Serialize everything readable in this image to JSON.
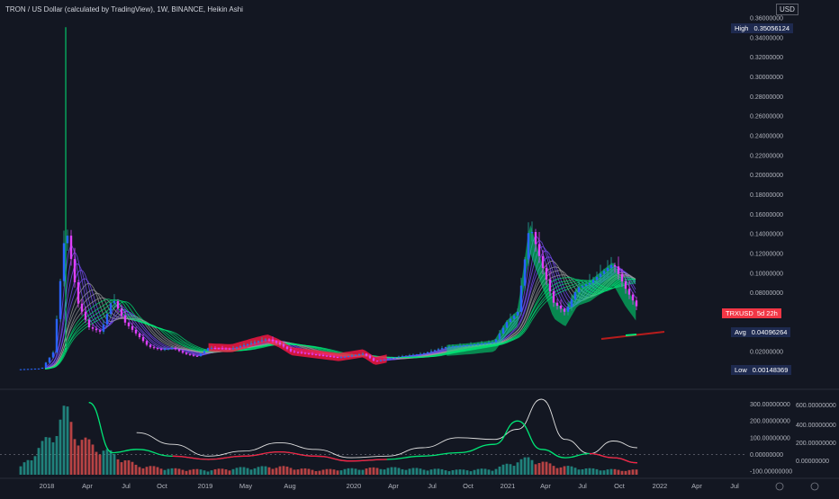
{
  "chart_title": "TRON / US Dollar (calculated by TradingView), 1W, BINANCE, Heikin Ashi",
  "currency": "USD",
  "colors": {
    "background": "#131722",
    "up_candle": "#26a69a",
    "down_candle": "#ef5350",
    "ribbon_green": "#00e676",
    "ribbon_red": "#ff1744",
    "ribbon_gray": "#9e9e9e",
    "oscillator_green": "#00e676",
    "oscillator_red": "#ff1744",
    "oscillator_white": "#e0e0e0",
    "volume_up": "#26a69a",
    "volume_down": "#ef5350"
  },
  "price_scale": {
    "ticks": [
      "0.36000000",
      "0.34000000",
      "0.32000000",
      "0.30000000",
      "0.28000000",
      "0.26000000",
      "0.24000000",
      "0.22000000",
      "0.20000000",
      "0.18000000",
      "0.16000000",
      "0.14000000",
      "0.12000000",
      "0.10000000",
      "0.08000000",
      "0.02000000"
    ]
  },
  "markers": {
    "high": {
      "key": "High",
      "value": "0.35056124"
    },
    "avg": {
      "key": "Avg",
      "value": "0.04096264"
    },
    "low": {
      "key": "Low",
      "value": "0.00148369"
    },
    "last": {
      "key": "TRXUSD",
      "value": "5d 22h"
    }
  },
  "indicator_scale": {
    "left_ticks": [
      "300.00000000",
      "200.00000000",
      "100.00000000",
      "0.00000000",
      "-100.00000000"
    ],
    "right_ticks": [
      "600.00000000",
      "400.00000000",
      "200.00000000",
      "0.00000000"
    ]
  },
  "time_axis": [
    "2018",
    "Apr",
    "Jul",
    "Oct",
    "2019",
    "May",
    "Aug",
    "2020",
    "Apr",
    "Jul",
    "Oct",
    "2021",
    "Apr",
    "Jul",
    "Oct",
    "2022",
    "Apr",
    "Jul"
  ],
  "chart_data": [
    {
      "type": "line",
      "chart_style": "Heikin Ashi candlesticks",
      "x_type": "date",
      "ylim": [
        0,
        0.36
      ],
      "x": [
        "2017-09",
        "2017-11",
        "2017-12",
        "2018-01",
        "2018-02",
        "2018-03",
        "2018-04",
        "2018-05",
        "2018-06",
        "2018-07",
        "2018-08",
        "2018-09",
        "2018-10",
        "2018-11",
        "2018-12",
        "2019-01",
        "2019-03",
        "2019-05",
        "2019-06",
        "2019-07",
        "2019-08",
        "2019-10",
        "2019-12",
        "2020-02",
        "2020-03",
        "2020-05",
        "2020-07",
        "2020-09",
        "2020-11",
        "2021-01",
        "2021-02",
        "2021-03",
        "2021-04",
        "2021-05",
        "2021-06",
        "2021-07",
        "2021-08",
        "2021-09",
        "2021-10",
        "2021-11",
        "2021-12",
        "2022-01"
      ],
      "series": [
        {
          "values": [
            0.002,
            0.003,
            0.02,
            0.15,
            0.07,
            0.045,
            0.04,
            0.075,
            0.05,
            0.038,
            0.025,
            0.022,
            0.024,
            0.018,
            0.015,
            0.024,
            0.023,
            0.03,
            0.033,
            0.028,
            0.02,
            0.017,
            0.014,
            0.018,
            0.01,
            0.015,
            0.018,
            0.025,
            0.027,
            0.03,
            0.05,
            0.06,
            0.15,
            0.11,
            0.07,
            0.06,
            0.085,
            0.09,
            0.1,
            0.11,
            0.085,
            0.065
          ]
        }
      ],
      "high": 0.35056124,
      "low": 0.00148369,
      "avg": 0.04096264
    },
    {
      "type": "bar",
      "x_type": "date",
      "categories": [
        "2017-09",
        "2017-12",
        "2018-01",
        "2018-02",
        "2018-04",
        "2018-05",
        "2018-07",
        "2018-10",
        "2019-01",
        "2019-04",
        "2019-07",
        "2019-10",
        "2020-01",
        "2020-04",
        "2020-07",
        "2020-10",
        "2021-01",
        "2021-03",
        "2021-04",
        "2021-06",
        "2021-09",
        "2021-12"
      ],
      "values": [
        20,
        180,
        280,
        160,
        110,
        90,
        40,
        25,
        20,
        30,
        35,
        20,
        25,
        30,
        25,
        20,
        25,
        60,
        70,
        40,
        25,
        20
      ]
    },
    {
      "type": "line",
      "x_type": "date",
      "ylim": [
        -100,
        330
      ],
      "x": [
        "2018-03",
        "2018-05",
        "2018-07",
        "2018-10",
        "2019-01",
        "2019-04",
        "2019-07",
        "2019-10",
        "2020-01",
        "2020-04",
        "2020-07",
        "2020-10",
        "2021-01",
        "2021-03",
        "2021-05",
        "2021-07",
        "2021-09",
        "2021-11",
        "2022-01"
      ],
      "series": [
        {
          "values": [
            310,
            10,
            30,
            -10,
            -30,
            -10,
            15,
            -10,
            -40,
            -30,
            -10,
            10,
            60,
            200,
            30,
            -20,
            5,
            -20,
            -50
          ]
        },
        {
          "values": [
            null,
            null,
            130,
            60,
            -10,
            20,
            70,
            30,
            -20,
            -10,
            40,
            100,
            90,
            150,
            330,
            90,
            5,
            80,
            40
          ]
        }
      ]
    }
  ]
}
